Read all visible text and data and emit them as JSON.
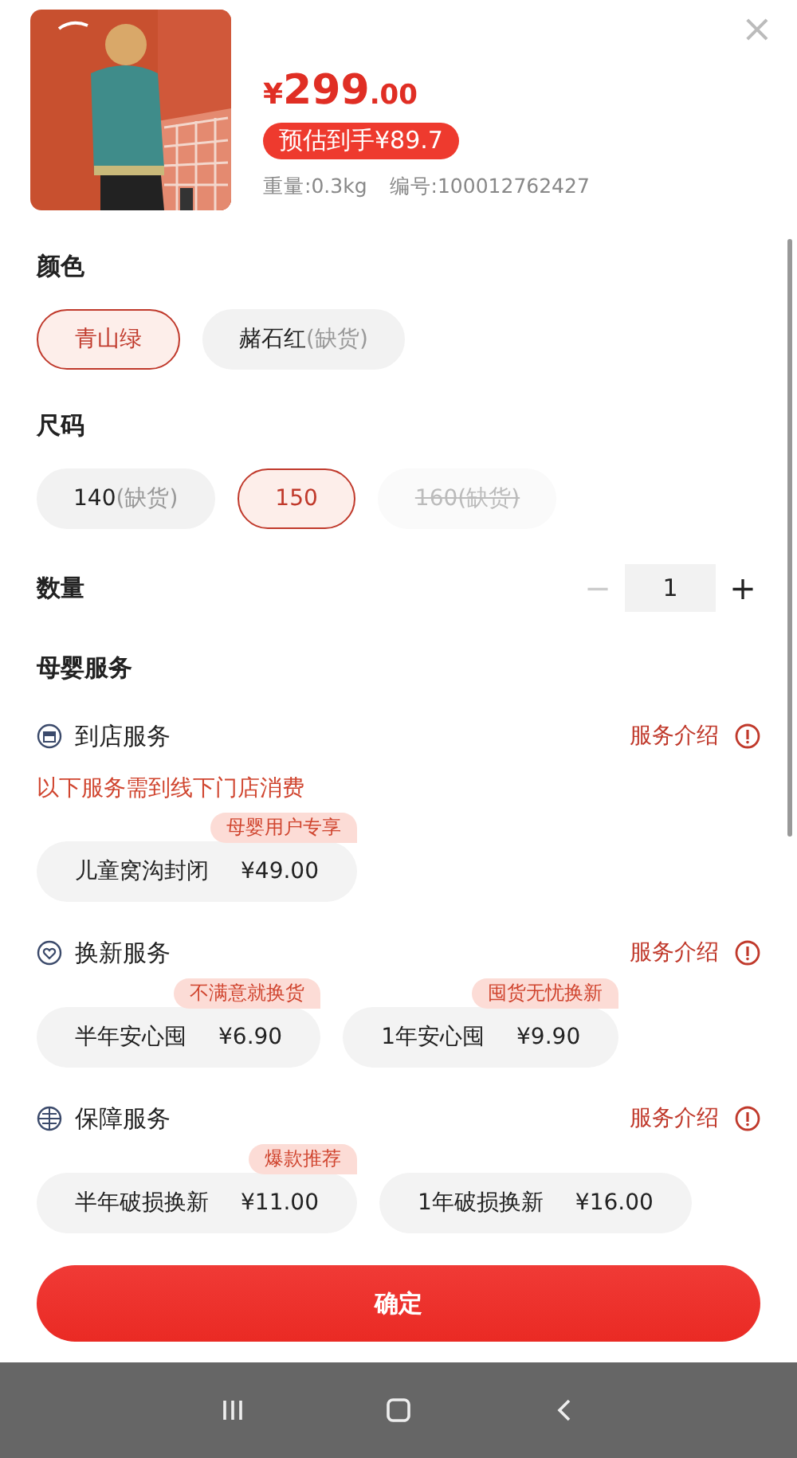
{
  "product": {
    "price_symbol": "¥",
    "price_main": "299",
    "price_decimal": ".00",
    "estimate": "预估到手¥89.7",
    "weight": "重量:0.3kg",
    "sku": "编号:100012762427"
  },
  "close": "×",
  "color": {
    "title": "颜色",
    "options": [
      {
        "label": "青山绿",
        "selected": true,
        "disabled": false
      },
      {
        "label": "赭石红",
        "note": "(缺货)",
        "selected": false,
        "disabled": false
      }
    ]
  },
  "size": {
    "title": "尺码",
    "options": [
      {
        "label": "140",
        "note": "(缺货)",
        "selected": false,
        "disabled": false
      },
      {
        "label": "150",
        "selected": true,
        "disabled": false
      },
      {
        "label": "160",
        "note": "(缺货)",
        "selected": false,
        "disabled": true
      }
    ]
  },
  "quantity": {
    "title": "数量",
    "minus": "−",
    "value": "1",
    "plus": "+",
    "minus_disabled": true
  },
  "services_title": "母婴服务",
  "services": [
    {
      "kind": "store",
      "title": "到店服务",
      "link": "服务介绍",
      "notice": "以下服务需到线下门店消费",
      "options": [
        {
          "name": "儿童窝沟封闭",
          "price": "¥49.00",
          "badge": "母婴用户专享"
        }
      ]
    },
    {
      "kind": "heart",
      "title": "换新服务",
      "link": "服务介绍",
      "options": [
        {
          "name": "半年安心囤",
          "price": "¥6.90",
          "badge": "不满意就换货"
        },
        {
          "name": "1年安心囤",
          "price": "¥9.90",
          "badge": "囤货无忧换新"
        }
      ]
    },
    {
      "kind": "globe",
      "title": "保障服务",
      "link": "服务介绍",
      "options": [
        {
          "name": "半年破损换新",
          "price": "¥11.00",
          "badge": "爆款推荐"
        },
        {
          "name": "1年破损换新",
          "price": "¥16.00"
        }
      ]
    }
  ],
  "confirm": "确定"
}
